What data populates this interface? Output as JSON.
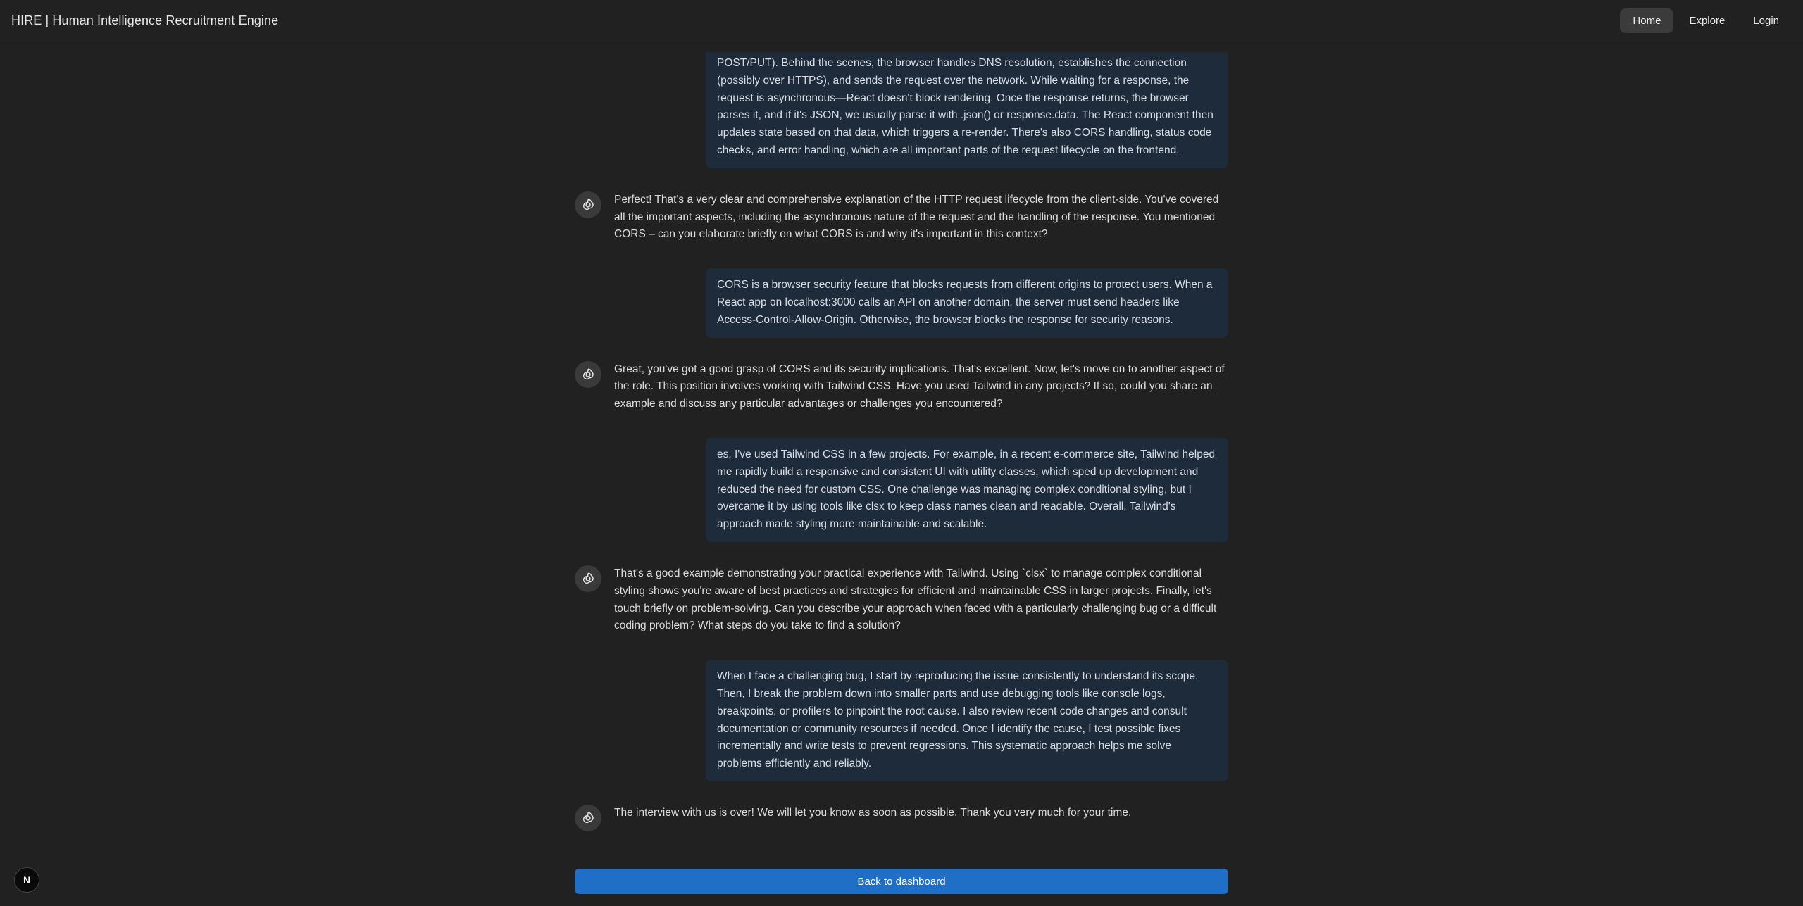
{
  "header": {
    "title": "HIRE | Human Intelligence Recruitment Engine",
    "nav": {
      "home": "Home",
      "explore": "Explore",
      "login": "Login"
    }
  },
  "messages": {
    "user_1": "POST/PUT). Behind the scenes, the browser handles DNS resolution, establishes the connection (possibly over HTTPS), and sends the request over the network. While waiting for a response, the request is asynchronous—React doesn't block rendering. Once the response returns, the browser parses it, and if it's JSON, we usually parse it with .json() or response.data. The React component then updates state based on that data, which triggers a re-render. There's also CORS handling, status code checks, and error handling, which are all important parts of the request lifecycle on the frontend.",
    "bot_1": "Perfect! That's a very clear and comprehensive explanation of the HTTP request lifecycle from the client-side. You've covered all the important aspects, including the asynchronous nature of the request and the handling of the response. You mentioned CORS – can you elaborate briefly on what CORS is and why it's important in this context?",
    "user_2": "CORS is a browser security feature that blocks requests from different origins to protect users. When a React app on localhost:3000 calls an API on another domain, the server must send headers like Access-Control-Allow-Origin. Otherwise, the browser blocks the response for security reasons.",
    "bot_2": "Great, you've got a good grasp of CORS and its security implications. That's excellent. Now, let's move on to another aspect of the role. This position involves working with Tailwind CSS. Have you used Tailwind in any projects? If so, could you share an example and discuss any particular advantages or challenges you encountered?",
    "user_3": "es, I've used Tailwind CSS in a few projects. For example, in a recent e-commerce site, Tailwind helped me rapidly build a responsive and consistent UI with utility classes, which sped up development and reduced the need for custom CSS. One challenge was managing complex conditional styling, but I overcame it by using tools like clsx to keep class names clean and readable. Overall, Tailwind's approach made styling more maintainable and scalable.",
    "bot_3": "That's a good example demonstrating your practical experience with Tailwind. Using `clsx` to manage complex conditional styling shows you're aware of best practices and strategies for efficient and maintainable CSS in larger projects. Finally, let's touch briefly on problem-solving. Can you describe your approach when faced with a particularly challenging bug or a difficult coding problem? What steps do you take to find a solution?",
    "user_4": "When I face a challenging bug, I start by reproducing the issue consistently to understand its scope. Then, I break the problem down into smaller parts and use debugging tools like console logs, breakpoints, or profilers to pinpoint the root cause. I also review recent code changes and consult documentation or community resources if needed. Once I identify the cause, I test possible fixes incrementally and write tests to prevent regressions. This systematic approach helps me solve problems efficiently and reliably.",
    "bot_4": "The interview with us is over! We will let you know as soon as possible. Thank you very much for your time."
  },
  "footer": {
    "back_button": "Back to dashboard",
    "badge_letter": "N"
  },
  "icons": {
    "bot_avatar": "openai-logo-icon",
    "corner_badge": "nextjs-logo-icon"
  },
  "colors": {
    "background": "#212121",
    "user_bubble": "#1e2b3a",
    "primary_button": "#1f6fc7"
  }
}
